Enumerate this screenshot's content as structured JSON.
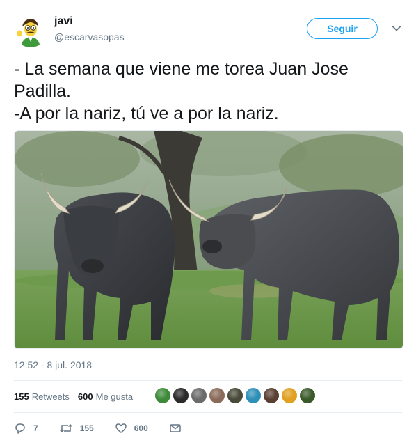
{
  "user": {
    "name": "javi",
    "handle": "@escarvasopas"
  },
  "header": {
    "follow_label": "Seguir"
  },
  "tweet": {
    "text": "- La semana que viene me torea Juan Jose Padilla.\n-A por la nariz, tú ve a por la nariz.",
    "timestamp": "12:52 - 8 jul. 2018"
  },
  "stats": {
    "retweets_count": "155",
    "retweets_label": "Retweets",
    "likes_count": "600",
    "likes_label": "Me gusta"
  },
  "likers": [
    {
      "icon": "avatar",
      "color": "#3f8a3a"
    },
    {
      "icon": "avatar",
      "color": "#2b2b2b"
    },
    {
      "icon": "avatar",
      "color": "#6b6b6b"
    },
    {
      "icon": "avatar",
      "color": "#8a6a5a"
    },
    {
      "icon": "avatar",
      "color": "#4a4a3a"
    },
    {
      "icon": "avatar",
      "color": "#2e8fb8"
    },
    {
      "icon": "avatar",
      "color": "#5a4032"
    },
    {
      "icon": "avatar",
      "color": "#e0a020"
    },
    {
      "icon": "avatar",
      "color": "#3a5a2a"
    }
  ],
  "actions": {
    "replies": "7",
    "retweets": "155",
    "likes": "600"
  },
  "colors": {
    "accent": "#1da1f2",
    "text": "#14171a",
    "secondary": "#657786",
    "divider": "#e6ecf0"
  },
  "icons": [
    "reply-icon",
    "retweet-icon",
    "like-icon",
    "dm-icon",
    "chevron-down-icon"
  ]
}
